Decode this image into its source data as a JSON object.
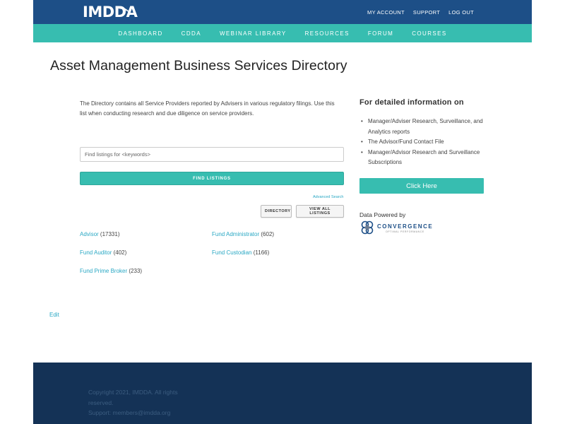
{
  "header": {
    "logo_text": "IMDDA",
    "top_links": [
      "MY ACCOUNT",
      "SUPPORT",
      "LOG OUT"
    ]
  },
  "nav": {
    "items": [
      "DASHBOARD",
      "CDDA",
      "WEBINAR LIBRARY",
      "RESOURCES",
      "FORUM",
      "COURSES"
    ]
  },
  "main": {
    "title": "Asset Management Business Services Directory",
    "intro": "The Directory contains all Service Providers reported by Advisers in various regulatory filings.  Use this list when conducting research and due diligence on service providers.",
    "search": {
      "placeholder": "Find listings for <keywords>",
      "button_label": "FIND LISTINGS",
      "advanced_link": "Advanced Search"
    },
    "buttons": {
      "directory": "DIRECTORY",
      "view_all": "VIEW ALL LISTINGS"
    },
    "categories": [
      {
        "name": "Advisor",
        "count": "(17331)"
      },
      {
        "name": "Fund Administrator",
        "count": "(602)"
      },
      {
        "name": "Fund Auditor",
        "count": "(402)"
      },
      {
        "name": "Fund Custodian",
        "count": "(1166)"
      },
      {
        "name": "Fund Prime Broker",
        "count": "(233)"
      }
    ],
    "edit_link": "Edit"
  },
  "sidebar": {
    "title": "For detailed information on",
    "items": [
      "Manager/Adviser Research, Surveillance, and Analytics reports",
      "The Advisor/Fund Contact File",
      "Manager/Advisor Research and Surveillance Subscriptions"
    ],
    "cta_label": "Click Here",
    "powered_label": "Data Powered by",
    "partner_logo": "CONVERGENCE",
    "partner_tagline": "OPTIMAL PERFORMANCE"
  },
  "footer": {
    "copyright": "Copyright 2021, IMDDA. All rights reserved.",
    "support": "Support: members@imdda.org"
  },
  "colors": {
    "header_blue": "#1d4f87",
    "nav_teal": "#37bdb0",
    "link_blue": "#2aa8c4",
    "footer_navy": "#143256"
  }
}
